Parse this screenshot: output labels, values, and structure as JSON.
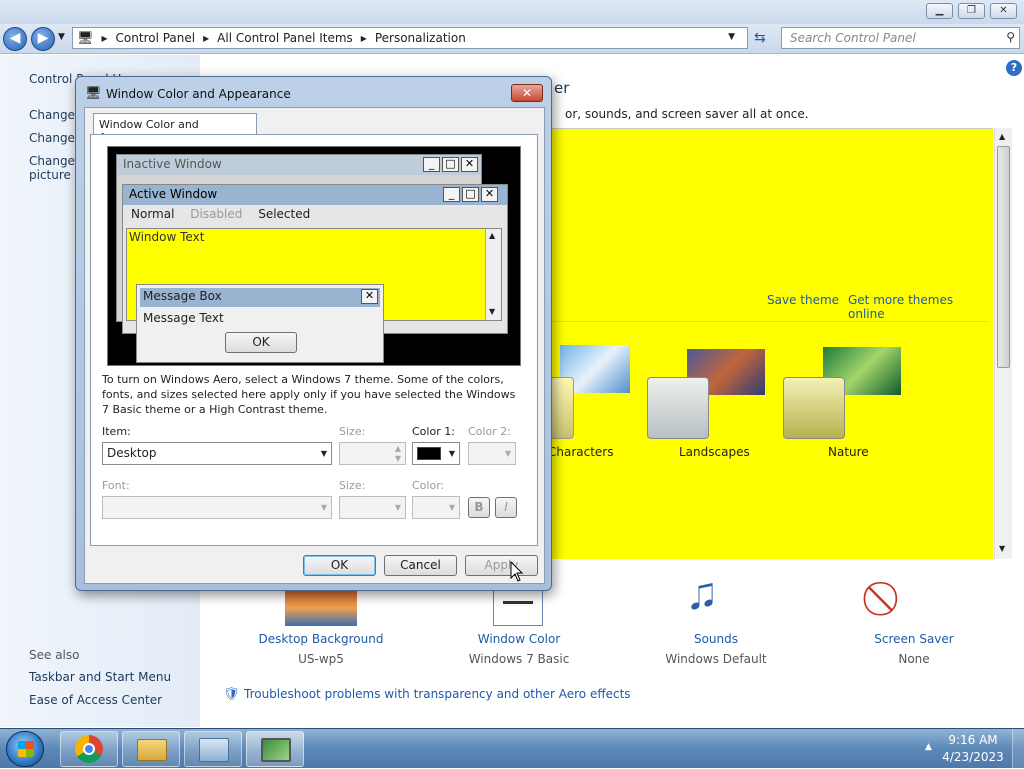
{
  "explorer": {
    "breadcrumb": [
      "Control Panel",
      "All Control Panel Items",
      "Personalization"
    ],
    "search_placeholder": "Search Control Panel",
    "left_pane": {
      "title": "Control Panel Home",
      "links": [
        "Change desktop icons",
        "Change mouse pointers",
        "Change your account picture"
      ],
      "see_also_heading": "See also",
      "see_also_links": [
        "Taskbar and Start Menu",
        "Ease of Access Center"
      ]
    },
    "content": {
      "heading_visible": "er",
      "description_visible": "or, sounds, and screen saver all at once.",
      "save_theme": "Save theme",
      "get_more_themes": "Get more themes online",
      "themes": [
        "Characters",
        "Landscapes",
        "Nature"
      ],
      "bottom_items": [
        {
          "label": "Desktop Background",
          "sub": "US-wp5"
        },
        {
          "label": "Window Color",
          "sub": "Windows 7 Basic"
        },
        {
          "label": "Sounds",
          "sub": "Windows Default"
        },
        {
          "label": "Screen Saver",
          "sub": "None"
        }
      ],
      "troubleshoot": "Troubleshoot problems with transparency and other Aero effects"
    }
  },
  "dialog": {
    "title": "Window Color and Appearance",
    "tab": "Window Color and Appearance",
    "preview": {
      "inactive_window": "Inactive Window",
      "active_window": "Active Window",
      "menu": [
        "Normal",
        "Disabled",
        "Selected"
      ],
      "window_text": "Window Text",
      "message_box": "Message Box",
      "message_text": "Message Text",
      "ok": "OK"
    },
    "info": "To turn on Windows Aero, select a Windows 7 theme.  Some of the colors, fonts, and sizes selected here apply only if you have selected the Windows 7 Basic theme or a High Contrast theme.",
    "item_label": "Item:",
    "item_value": "Desktop",
    "size_label": "Size:",
    "color1_label": "Color 1:",
    "color2_label": "Color 2:",
    "font_label": "Font:",
    "font_size_label": "Size:",
    "font_color_label": "Color:",
    "bold": "B",
    "italic": "I",
    "ok": "OK",
    "cancel": "Cancel",
    "apply": "Apply",
    "color1_value": "#000000"
  },
  "taskbar": {
    "time": "9:16 AM",
    "date": "4/23/2023"
  },
  "colors": {
    "desktop_theme_bg": "#ffff00",
    "accent": "#1e5aa8"
  }
}
